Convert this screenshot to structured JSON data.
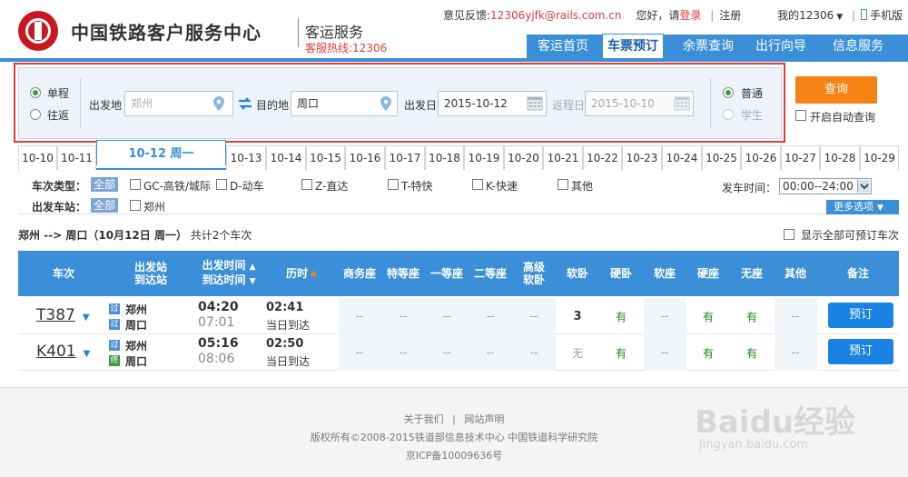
{
  "header": {
    "site_name": "中国铁路客户服务中心",
    "subsite": "客运服务",
    "hotline": "客服热线:12306",
    "feedback_label": "意见反馈:",
    "feedback_email": "12306yjfk@rails.com.cn",
    "greeting": "您好，请",
    "login": "登录",
    "register": "注册",
    "my12306": "我的12306",
    "mobile": "手机版",
    "nav": [
      "客运首页",
      "车票预订",
      "余票查询",
      "出行向导",
      "信息服务"
    ],
    "active_nav": "车票预订"
  },
  "search": {
    "trip_types": [
      "单程",
      "往返"
    ],
    "selected_trip": "单程",
    "from_label": "出发地",
    "from_value": "郑州",
    "to_label": "目的地",
    "to_value": "周口",
    "date_label": "出发日",
    "date_value": "2015-10-12",
    "return_label": "返程日",
    "return_value": "2015-10-10",
    "ticket_types": [
      "普通",
      "学生"
    ],
    "selected_ticket": "普通",
    "query_button": "查询",
    "auto_query_label": "开启自动查询"
  },
  "date_tabs": [
    "10-10",
    "10-11",
    "10-12 周一",
    "10-13",
    "10-14",
    "10-15",
    "10-16",
    "10-17",
    "10-18",
    "10-19",
    "10-20",
    "10-21",
    "10-22",
    "10-23",
    "10-24",
    "10-25",
    "10-26",
    "10-27",
    "10-28",
    "10-29"
  ],
  "active_date_tab": "10-12 周一",
  "filters": {
    "train_type_label": "车次类型：",
    "all_label": "全部",
    "train_types": [
      "GC-高铁/城际",
      "D-动车",
      "Z-直达",
      "T-特快",
      "K-快速",
      "其他"
    ],
    "station_label": "出发车站：",
    "stations": [
      "郑州"
    ],
    "depart_time_label": "发车时间：",
    "depart_time_value": "00:00--24:00",
    "more_options": "更多选项"
  },
  "summary": {
    "route": "郑州 --> 周口（10月12日  周一）",
    "count_text": "共计2个车次",
    "show_all_label": "显示全部可预订车次"
  },
  "table": {
    "headers": [
      "车次",
      "出发站\n到达站",
      "出发时间\n到达时间",
      "历时",
      "商务座",
      "特等座",
      "一等座",
      "二等座",
      "高级\n软卧",
      "软卧",
      "硬卧",
      "软座",
      "硬座",
      "无座",
      "其他",
      "备注"
    ],
    "rows": [
      {
        "train": "T387",
        "from": "郑州",
        "to": "周口",
        "from_tag": "过",
        "to_tag": "过",
        "depart": "04:20",
        "arrive": "07:01",
        "duration": "02:41",
        "arrive_day": "当日到达",
        "seats": [
          "--",
          "--",
          "--",
          "--",
          "--",
          "3",
          "有",
          "--",
          "有",
          "有",
          "--"
        ],
        "action": "预订"
      },
      {
        "train": "K401",
        "from": "郑州",
        "to": "周口",
        "from_tag": "过",
        "to_tag": "终",
        "depart": "05:16",
        "arrive": "08:06",
        "duration": "02:50",
        "arrive_day": "当日到达",
        "seats": [
          "--",
          "--",
          "--",
          "--",
          "--",
          "无",
          "有",
          "--",
          "有",
          "有",
          "--"
        ],
        "action": "预订"
      }
    ]
  },
  "footer": {
    "links": [
      "关于我们",
      "网站声明"
    ],
    "copyright": "版权所有©2008-2015铁道部信息技术中心   中国铁道科学研究院",
    "icp": "京ICP备10009636号"
  },
  "watermark": {
    "logo": "Baidu经验",
    "url": "jingyan.baidu.com"
  },
  "colors": {
    "brand_blue": "#3a8fd8",
    "accent_orange": "#f58215",
    "brand_red": "#c8171e",
    "available_green": "#1a8a1a"
  }
}
